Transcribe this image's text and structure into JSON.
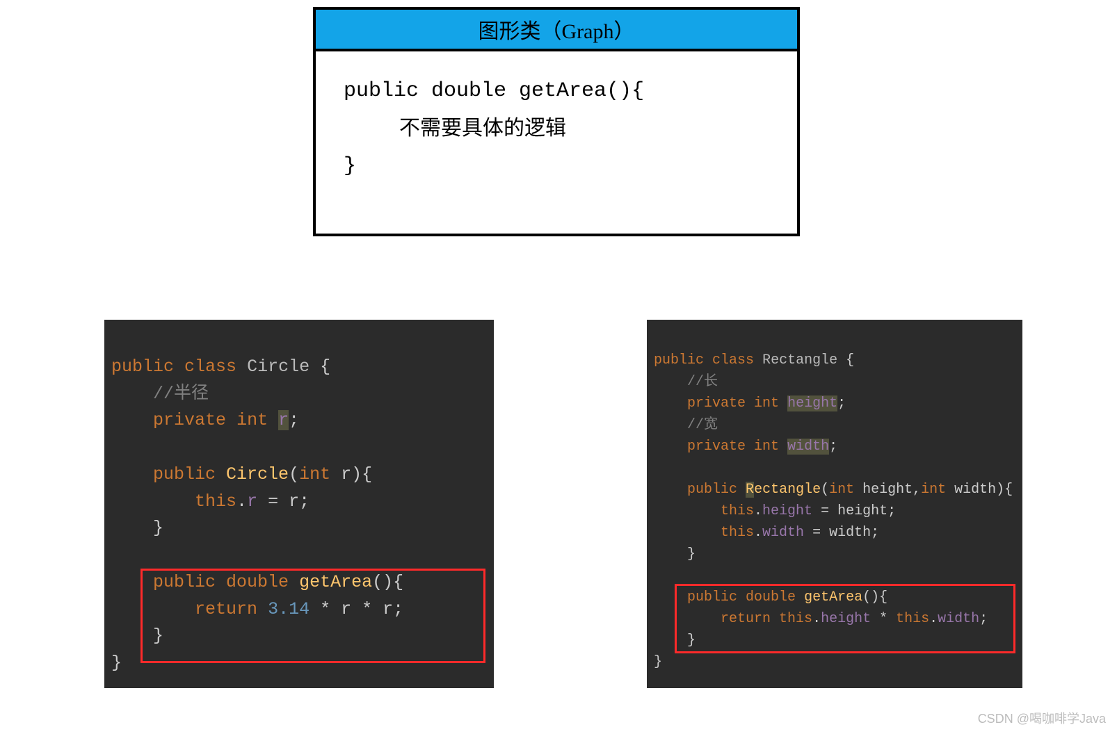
{
  "uml": {
    "header": "图形类（Graph）",
    "sig": "public double getArea(){",
    "note": "不需要具体的逻辑",
    "close": "}"
  },
  "circle": {
    "l1_kw1": "public",
    "l1_kw2": "class",
    "l1_cls": "Circle",
    "l1_brace": " {",
    "cmt1": "//半径",
    "fld1_kw1": "private",
    "fld1_kw2": "int",
    "fld1_name": "r",
    "fld1_semi": ";",
    "ctor_kw": "public",
    "ctor_name": "Circle",
    "ctor_sig_open": "(",
    "ctor_ptype": "int",
    "ctor_pname": " r",
    "ctor_sig_close": "){",
    "ctor_body_this": "this",
    "ctor_body_dot": ".",
    "ctor_body_field": "r",
    "ctor_body_eq": " = r;",
    "brace_close": "}",
    "ga_kw1": "public",
    "ga_kw2": "double",
    "ga_name": "getArea",
    "ga_sig": "(){",
    "ga_ret_kw": "return",
    "ga_num": "3.14",
    "ga_expr": " * r * r;",
    "class_close": "}"
  },
  "rectangle": {
    "l1_kw1": "public",
    "l1_kw2": "class",
    "l1_cls": "Rectangle",
    "l1_brace": " {",
    "cmt1": "//长",
    "f1_kw1": "private",
    "f1_kw2": "int",
    "f1_name": "height",
    "f1_semi": ";",
    "cmt2": "//宽",
    "f2_kw1": "private",
    "f2_kw2": "int",
    "f2_name": "width",
    "f2_semi": ";",
    "ctor_kw": "public",
    "ctor_name_open": "R",
    "ctor_name_rest": "ectangle",
    "ctor_sig_open": "(",
    "ctor_p1t": "int",
    "ctor_p1n": " height",
    "ctor_comma": ",",
    "ctor_p2t": "int",
    "ctor_p2n": " width",
    "ctor_sig_close": "){",
    "cb1_this": "this",
    "cb1_dot": ".",
    "cb1_f": "height",
    "cb1_rest": " = height;",
    "cb2_this": "this",
    "cb2_dot": ".",
    "cb2_f": "width",
    "cb2_rest": " = width;",
    "brace_close": "}",
    "ga_kw1": "public",
    "ga_kw2": "double",
    "ga_name": "getArea",
    "ga_sig": "(){",
    "ga_ret_kw": "return",
    "ga_this1": "this",
    "ga_d1": ".",
    "ga_f1": "height",
    "ga_mul": " * ",
    "ga_this2": "this",
    "ga_d2": ".",
    "ga_f2": "width",
    "ga_semi": ";",
    "class_close": "}"
  },
  "watermark": "CSDN @喝咖啡学Java"
}
